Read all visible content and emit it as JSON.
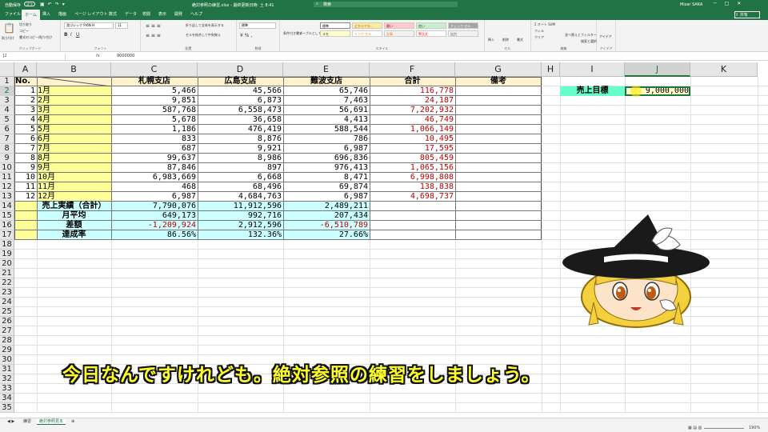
{
  "titlebar": {
    "autosave": "自動保存",
    "autosave_state": "オフ",
    "document": "絶対参照の練習.xlsx - 最終更新日時: 土 8:41",
    "search": "検索",
    "user": "Mizar SAKA"
  },
  "tabs": [
    "ファイル",
    "ホーム",
    "挿入",
    "描画",
    "ページ レイアウト",
    "数式",
    "データ",
    "校閲",
    "表示",
    "開発",
    "ヘルプ"
  ],
  "active_tab": "ホーム",
  "share_label": "共有",
  "ribbon": {
    "clipboard": {
      "label": "クリップボード",
      "paste": "貼り付け",
      "cut": "切り取り",
      "copy": "コピー",
      "painter": "書式のコピー/貼り付け"
    },
    "font": {
      "label": "フォント",
      "name": "游ゴシック Pr6N H",
      "size": "11"
    },
    "alignment": {
      "label": "配置",
      "wrap": "折り返して全体を表示する",
      "merge": "セルを結合して中央揃え"
    },
    "number": {
      "label": "数値",
      "format": "標準"
    },
    "styles": {
      "label": "スタイル",
      "cond": "条件付き書式",
      "table": "テーブルとして書式設定",
      "cells": [
        "標準",
        "どちらでも...",
        "悪い",
        "良い",
        "チェック セル",
        "メモ",
        "リンク セル",
        "計算",
        "警告文",
        "出力"
      ]
    },
    "cells": {
      "label": "セル",
      "insert": "挿入",
      "delete": "削除",
      "format": "書式"
    },
    "editing": {
      "label": "編集",
      "autosum": "オート SUM",
      "fill": "フィル",
      "clear": "クリア",
      "sort": "並べ替えとフィルター",
      "find": "検索と選択"
    },
    "ideas": {
      "label": "アイデア",
      "ideas": "アイデア"
    }
  },
  "formula_bar": {
    "name_box": "J2",
    "fx": "fx",
    "formula": "9000000"
  },
  "columns": [
    "A",
    "B",
    "C",
    "D",
    "E",
    "F",
    "G",
    "H",
    "I",
    "J",
    "K"
  ],
  "rows": [
    "1",
    "2",
    "3",
    "4",
    "5",
    "6",
    "7",
    "8",
    "9",
    "10",
    "11",
    "12",
    "13",
    "14",
    "15",
    "16",
    "17",
    "18",
    "19",
    "20",
    "21",
    "22",
    "23",
    "24",
    "25",
    "26",
    "27",
    "28",
    "29",
    "30",
    "31",
    "32",
    "33",
    "34",
    "35"
  ],
  "table": {
    "headers": {
      "no": "No.",
      "c": "札幌支店",
      "d": "広島支店",
      "e": "難波支店",
      "f": "合計",
      "g": "備考"
    },
    "months": [
      {
        "no": "1",
        "month": "1月",
        "c": "5,466",
        "d": "45,566",
        "e": "65,746",
        "f": "116,778"
      },
      {
        "no": "2",
        "month": "2月",
        "c": "9,851",
        "d": "6,873",
        "e": "7,463",
        "f": "24,187"
      },
      {
        "no": "3",
        "month": "3月",
        "c": "587,768",
        "d": "6,558,473",
        "e": "56,691",
        "f": "7,202,932"
      },
      {
        "no": "4",
        "month": "4月",
        "c": "5,678",
        "d": "36,658",
        "e": "4,413",
        "f": "46,749"
      },
      {
        "no": "5",
        "month": "5月",
        "c": "1,186",
        "d": "476,419",
        "e": "588,544",
        "f": "1,066,149"
      },
      {
        "no": "6",
        "month": "6月",
        "c": "833",
        "d": "8,876",
        "e": "786",
        "f": "10,495"
      },
      {
        "no": "7",
        "month": "7月",
        "c": "687",
        "d": "9,921",
        "e": "6,987",
        "f": "17,595"
      },
      {
        "no": "8",
        "month": "8月",
        "c": "99,637",
        "d": "8,986",
        "e": "696,836",
        "f": "805,459"
      },
      {
        "no": "9",
        "month": "9月",
        "c": "87,846",
        "d": "897",
        "e": "976,413",
        "f": "1,065,156"
      },
      {
        "no": "10",
        "month": "10月",
        "c": "6,983,669",
        "d": "6,668",
        "e": "8,471",
        "f": "6,998,808"
      },
      {
        "no": "11",
        "month": "11月",
        "c": "468",
        "d": "68,496",
        "e": "69,874",
        "f": "138,838"
      },
      {
        "no": "12",
        "month": "12月",
        "c": "6,987",
        "d": "4,684,763",
        "e": "6,987",
        "f": "4,698,737"
      }
    ],
    "summary": [
      {
        "label": "売上実績（合計）",
        "c": "7,790,076",
        "d": "11,912,596",
        "e": "2,489,211",
        "c_red": false,
        "d_red": false,
        "e_red": false
      },
      {
        "label": "月平均",
        "c": "649,173",
        "d": "992,716",
        "e": "207,434",
        "c_red": false,
        "d_red": false,
        "e_red": false
      },
      {
        "label": "差額",
        "c": "-1,209,924",
        "d": "2,912,596",
        "e": "-6,510,789",
        "c_red": true,
        "d_red": false,
        "e_red": true
      },
      {
        "label": "達成率",
        "c": "86.56%",
        "d": "132.36%",
        "e": "27.66%",
        "c_red": false,
        "d_red": false,
        "e_red": false
      }
    ]
  },
  "target": {
    "label": "売上目標",
    "value": "9,000,000"
  },
  "sheets": [
    "練習",
    "絶対参照見本"
  ],
  "active_sheet": "絶対参照見本",
  "status": {
    "zoom": "190%"
  },
  "subtitle": "今日なんですけれども。絶対参照の練習をしましょう。",
  "colors": {
    "excel_green": "#217346",
    "header_fill": "#fff2cc",
    "month_fill": "#ffff99",
    "summary_fill": "#ccffff",
    "target_fill": "#66ffcc",
    "negative": "#c00000",
    "subtitle": "#ffff2a"
  }
}
